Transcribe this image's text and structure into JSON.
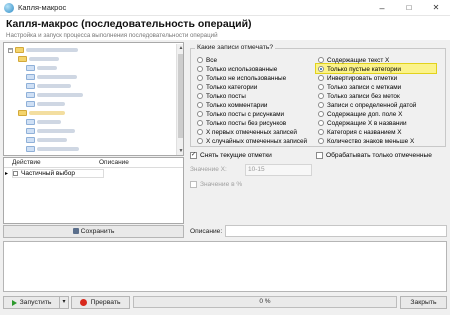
{
  "window": {
    "title": "Капля-макрос",
    "minimize": "–",
    "maximize": "□",
    "close": "✕"
  },
  "header": {
    "title": "Капля-макрос (последовательность операций)",
    "subtitle": "Настройка и запуск процесса выполнения последовательности операций"
  },
  "grid": {
    "columns": [
      "Действие",
      "Описание"
    ],
    "rows": [
      {
        "action": "Частичный выбор",
        "description": ""
      }
    ]
  },
  "buttons": {
    "save": "Сохранить",
    "run": "Запустить",
    "dropdown": "▾",
    "interrupt": "Прервать",
    "close": "Закрыть"
  },
  "group": {
    "title": "Какие записи отмечать?",
    "left": [
      "Все",
      "Только использованные",
      "Только не использованные",
      "Только категории",
      "Только посты",
      "Только комментарии",
      "Только посты с рисунками",
      "Только посты без рисунков",
      "X первых отмеченных записей",
      "X случайных отмеченных записей"
    ],
    "right": [
      "Содержащие текст X",
      "Только пустые категории",
      "Инвертировать отметки",
      "Только записи с метками",
      "Только записи без меток",
      "Записи с определенной датой",
      "Содержащие доп. поле X",
      "Содержащие X в названии",
      "Категория с названием X",
      "Количество знаков меньше X"
    ],
    "selected": "Только пустые категории",
    "highlight_color": "#fbf38a"
  },
  "options": {
    "clear_marks": "Снять текущие отметки",
    "process_marked": "Обрабатывать только отмеченные",
    "value_x_label": "Значение X:",
    "value_x": "10-15",
    "value_pct": "Значение в %",
    "description_label": "Описание:"
  },
  "progress": {
    "text": "0 %",
    "value": 0
  }
}
